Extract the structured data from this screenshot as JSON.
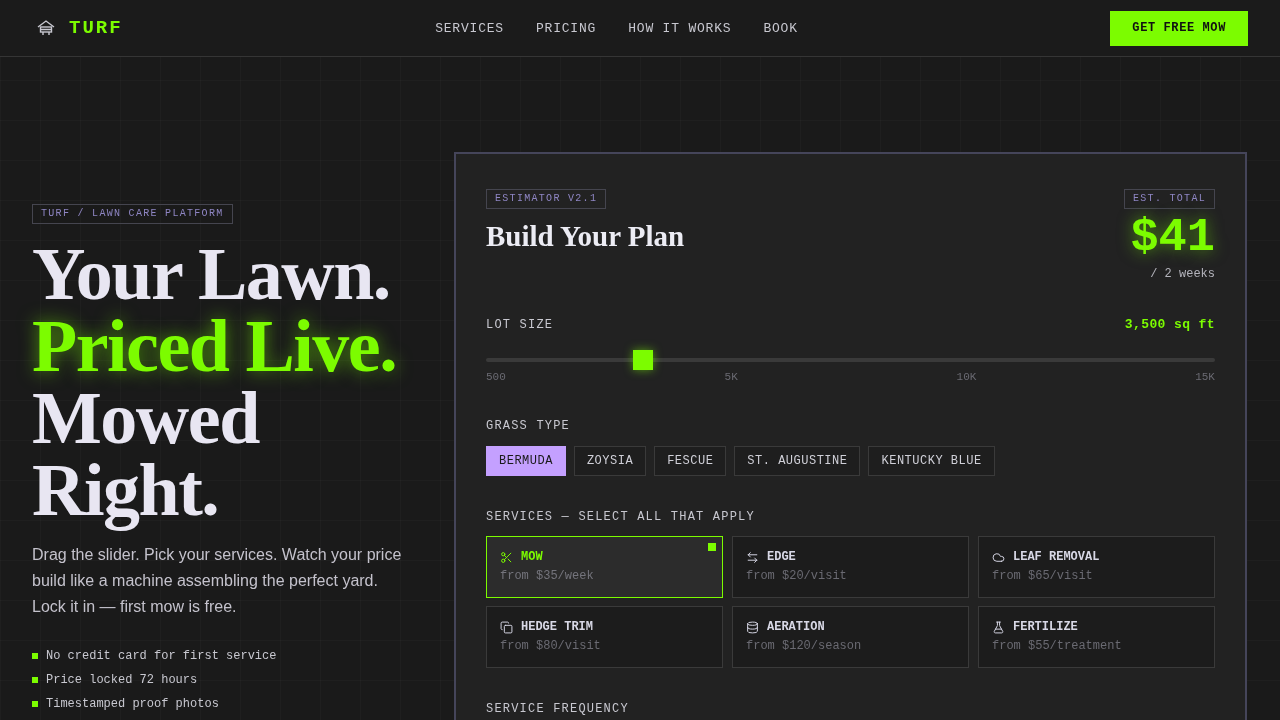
{
  "nav": {
    "logo": "TURF",
    "links": [
      "SERVICES",
      "PRICING",
      "HOW IT WORKS",
      "BOOK"
    ],
    "cta": "GET FREE MOW"
  },
  "hero": {
    "tag": "TURF / LAWN CARE PLATFORM",
    "headline": [
      {
        "text": "Your Lawn.",
        "highlight": false
      },
      {
        "text": "Priced Live.",
        "highlight": true
      },
      {
        "text": "Mowed Right.",
        "highlight": false
      }
    ],
    "description": "Drag the slider. Pick your services. Watch your price build like a machine assembling the perfect yard. Lock it in — first mow is free.",
    "bullets": [
      "No credit card for first service",
      "Price locked 72 hours",
      "Timestamped proof photos"
    ]
  },
  "estimator": {
    "tag": "ESTIMATOR V2.1",
    "title": "Build Your Plan",
    "total_label": "EST. TOTAL",
    "total": "$41",
    "period": "/ 2 weeks",
    "lot_size": {
      "label": "LOT SIZE",
      "reading": "3,500 sq ft",
      "level": 0.207,
      "ticks": [
        "500",
        "5K",
        "10K",
        "15K"
      ]
    },
    "grass_type": {
      "label": "GRASS TYPE",
      "options": [
        {
          "label": "BERMUDA",
          "selected": true
        },
        {
          "label": "ZOYSIA",
          "selected": false
        },
        {
          "label": "FESCUE",
          "selected": false
        },
        {
          "label": "ST. AUGUSTINE",
          "selected": false
        },
        {
          "label": "KENTUCKY BLUE",
          "selected": false
        }
      ]
    },
    "services": {
      "label": "SERVICES — SELECT ALL THAT APPLY",
      "items": [
        {
          "kind": "mow",
          "name": "MOW",
          "price": "from $35/week",
          "selected": true
        },
        {
          "kind": "edge",
          "name": "EDGE",
          "price": "from $20/visit",
          "selected": false
        },
        {
          "kind": "leaf",
          "name": "LEAF REMOVAL",
          "price": "from $65/visit",
          "selected": false
        },
        {
          "kind": "hedge",
          "name": "HEDGE TRIM",
          "price": "from $80/visit",
          "selected": false
        },
        {
          "kind": "aeration",
          "name": "AERATION",
          "price": "from $120/season",
          "selected": false
        },
        {
          "kind": "fertilize",
          "name": "FERTILIZE",
          "price": "from $55/treatment",
          "selected": false
        }
      ]
    },
    "frequency": {
      "label": "SERVICE FREQUENCY"
    }
  }
}
